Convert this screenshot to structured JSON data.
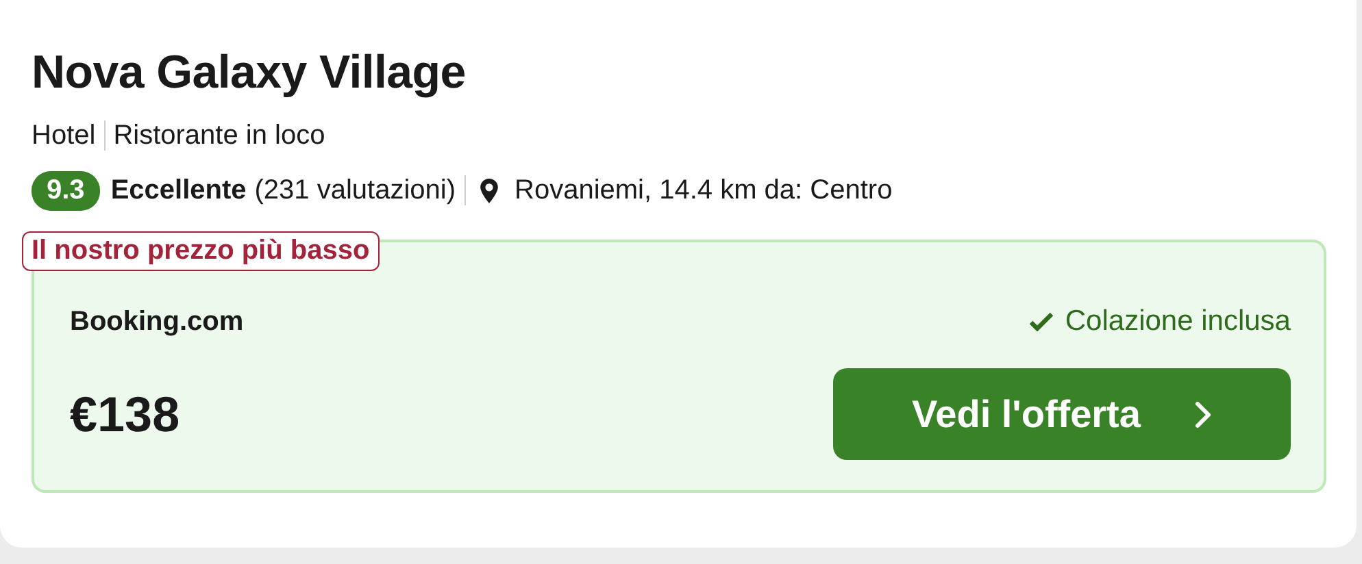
{
  "hotel": {
    "name": "Nova Galaxy Village",
    "tags": [
      "Hotel",
      "Ristorante in loco"
    ],
    "rating": {
      "score": "9.3",
      "label": "Eccellente",
      "count": "(231 valutazioni)"
    },
    "location": "Rovaniemi, 14.4 km da: Centro"
  },
  "offer": {
    "badge": "Il nostro prezzo più basso",
    "provider": "Booking.com",
    "perk": "Colazione inclusa",
    "price": "€138",
    "button": "Vedi l'offerta"
  }
}
